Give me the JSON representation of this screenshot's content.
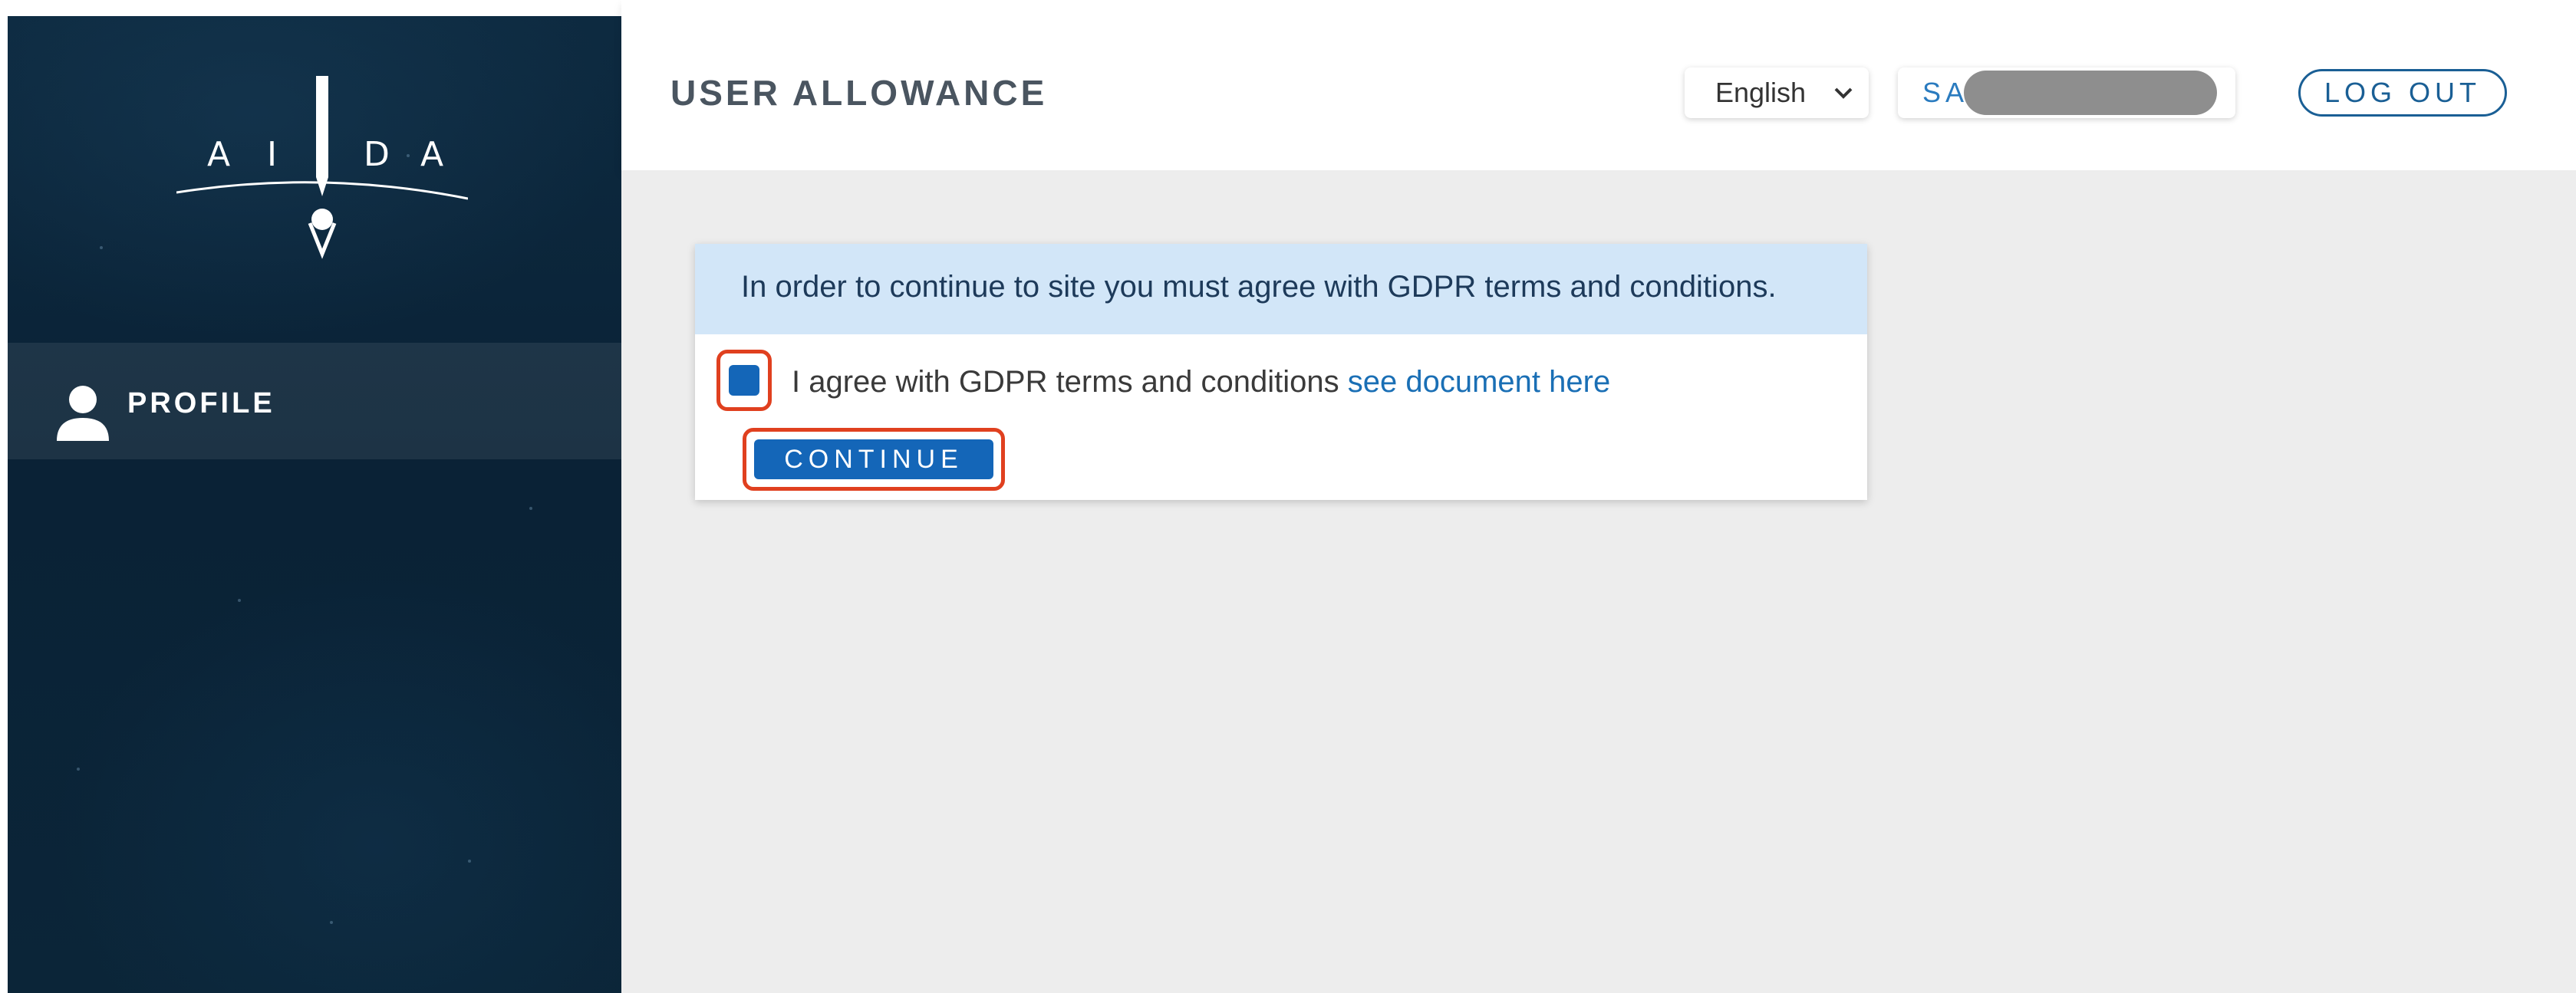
{
  "sidebar": {
    "logo_letters": [
      "A",
      "I",
      "D",
      "A"
    ],
    "items": [
      {
        "label": "PROFILE",
        "icon": "user-icon"
      }
    ]
  },
  "header": {
    "title": "USER ALLOWANCE",
    "language": {
      "selected": "English",
      "icon": "chevron-down-icon"
    },
    "user": {
      "visible_text": "SA"
    },
    "logout_label": "LOG OUT"
  },
  "gdpr": {
    "notice": "In order to continue to site you must agree with GDPR terms and conditions.",
    "agree_text": "I agree with GDPR terms and conditions ",
    "agree_link": "see document here",
    "checkbox_checked": true,
    "continue_label": "CONTINUE"
  },
  "colors": {
    "sidebar_bg": "#0b2538",
    "accent": "#1466b8",
    "highlight": "#e0401f",
    "notice_bg": "#d2e6f8",
    "content_bg": "#ededed"
  }
}
